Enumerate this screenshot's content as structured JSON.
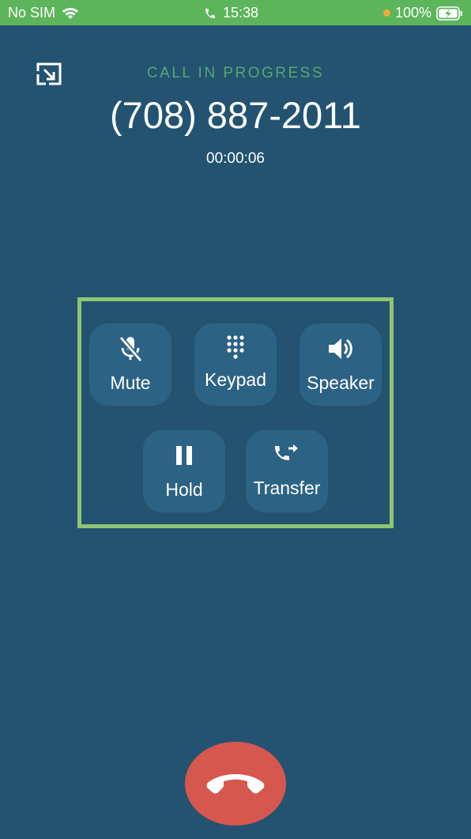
{
  "status_bar": {
    "carrier": "No SIM",
    "time": "15:38",
    "battery": "100%",
    "dot_color": "#f2a93b",
    "bar_color": "#5cb55b"
  },
  "call": {
    "status": "CALL IN PROGRESS",
    "number": "(708) 887-2011",
    "duration": "00:00:06"
  },
  "controls": {
    "mute": {
      "label": "Mute",
      "icon": "mic-off-icon"
    },
    "keypad": {
      "label": "Keypad",
      "icon": "dialpad-icon"
    },
    "speaker": {
      "label": "Speaker",
      "icon": "speaker-icon"
    },
    "hold": {
      "label": "Hold",
      "icon": "pause-icon"
    },
    "transfer": {
      "label": "Transfer",
      "icon": "call-transfer-icon"
    }
  },
  "colors": {
    "background": "#235371",
    "button_bg": "#2c6384",
    "highlight_frame": "#8fc671",
    "status_text": "#58a86f",
    "end_call": "#d6574d"
  }
}
